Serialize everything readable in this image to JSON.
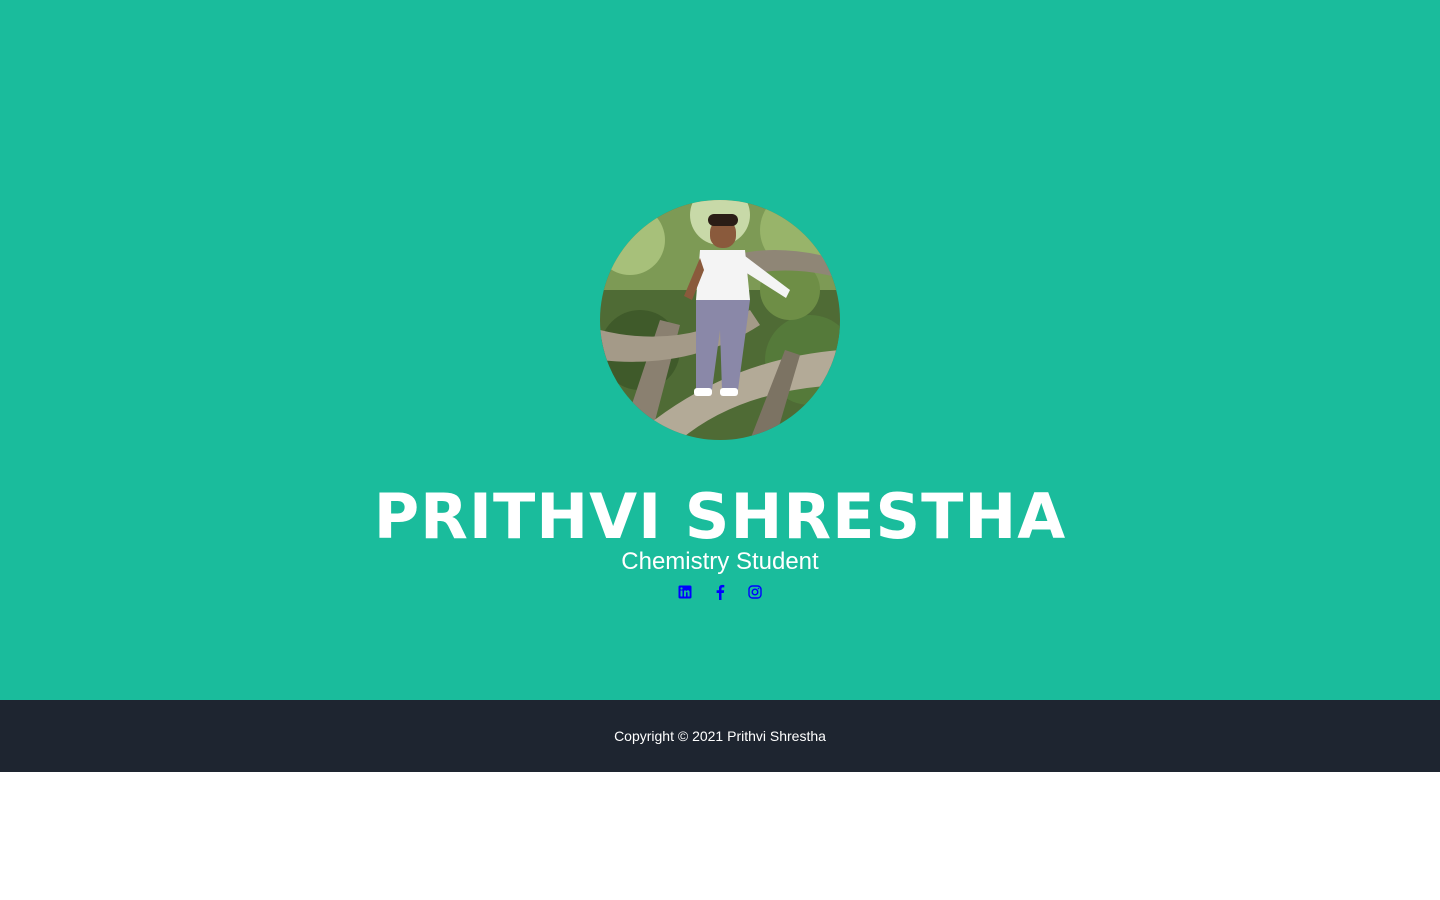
{
  "hero": {
    "name": "PRITHVI SHRESTHA",
    "subtitle": "Chemistry Student",
    "avatar_alt": "profile-photo",
    "background_color": "#1abc9c",
    "social_links": [
      {
        "icon": "linkedin-icon",
        "color": "#0000ff"
      },
      {
        "icon": "facebook-icon",
        "color": "#0000ff"
      },
      {
        "icon": "instagram-icon",
        "color": "#0000ff"
      }
    ]
  },
  "footer": {
    "copyright": "Copyright © 2021 Prithvi Shrestha",
    "background_color": "#1e2530"
  }
}
